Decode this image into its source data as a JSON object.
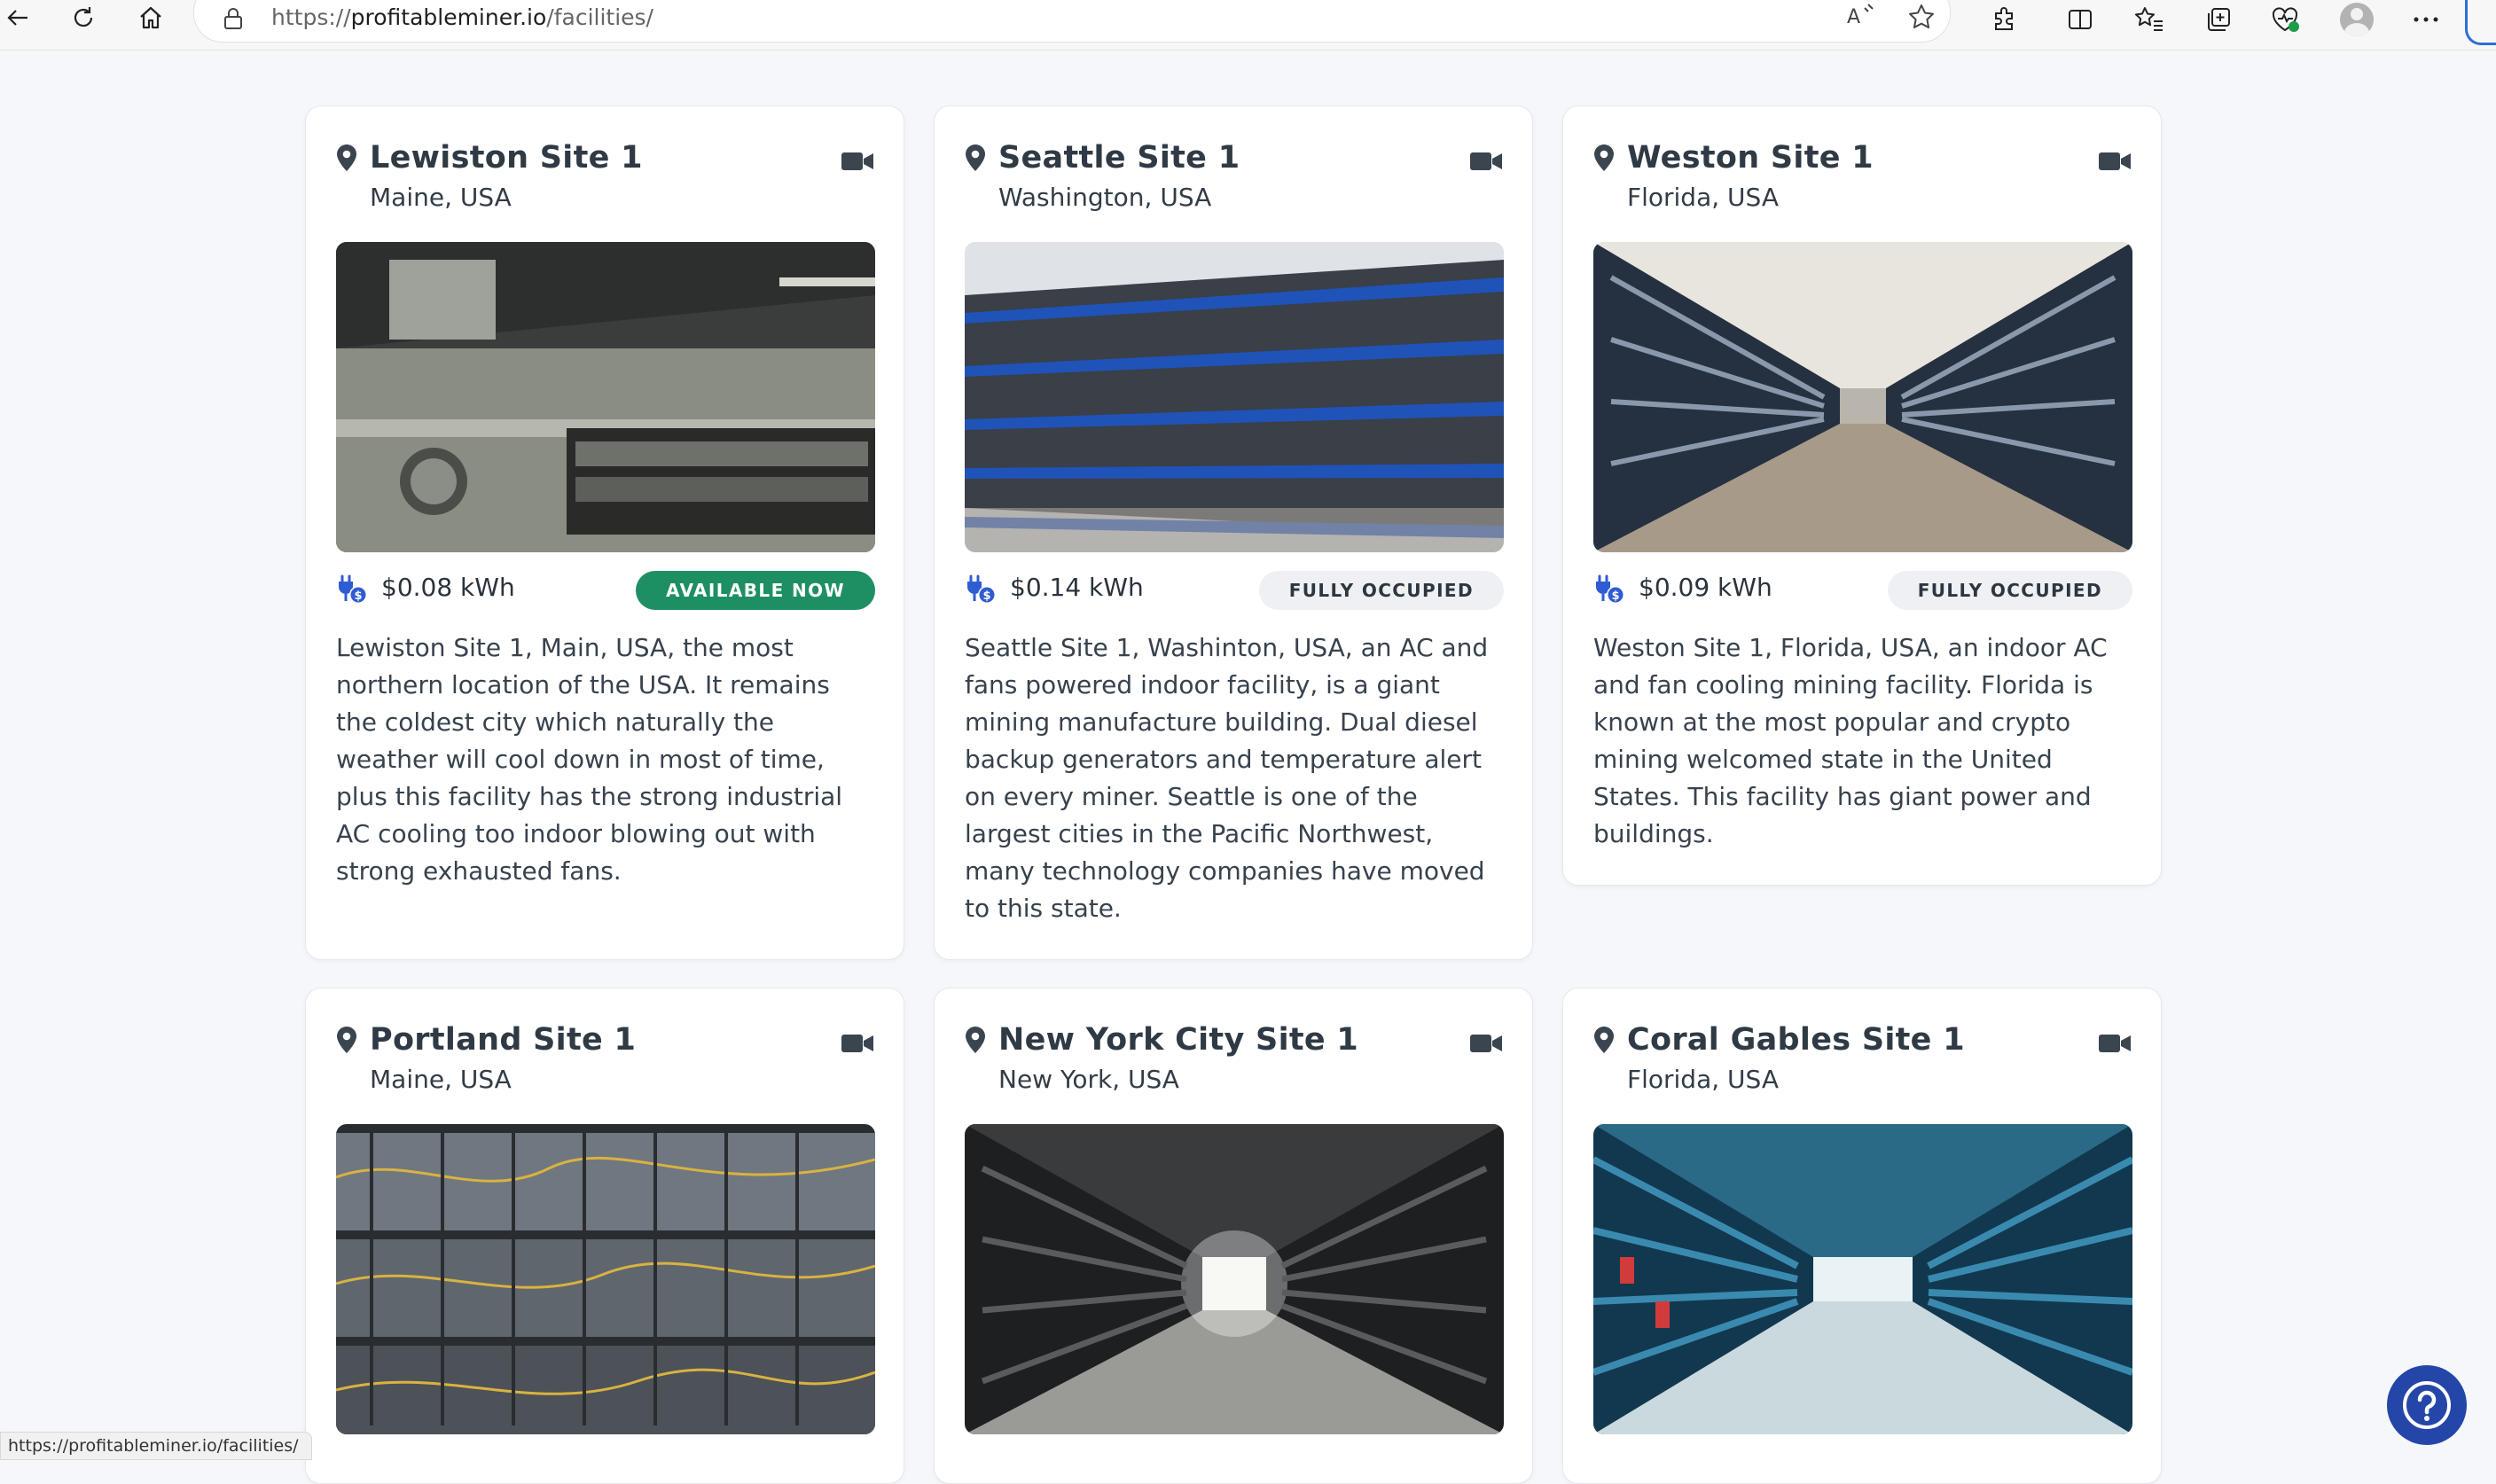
{
  "browser": {
    "url_prefix": "https://",
    "url_host": "profitableminer.io",
    "url_path": "/facilities/",
    "status_url": "https://profitableminer.io/facilities/",
    "icons": [
      "back-icon",
      "refresh-icon",
      "home-icon",
      "lock-icon",
      "read-aloud-icon",
      "favorite-star-icon",
      "extensions-icon",
      "split-screen-icon",
      "favorites-icon",
      "collections-icon",
      "browser-essentials-icon",
      "profile-avatar-icon",
      "more-options-icon"
    ]
  },
  "facilities": [
    {
      "name": "Lewiston Site 1",
      "location": "Maine, USA",
      "price": "$0.08 kWh",
      "status": "AVAILABLE NOW",
      "status_type": "available",
      "description": "Lewiston Site 1, Main, USA, the most northern location of the USA. It remains the coldest city which naturally the weather will cool down in most of time, plus this facility has the strong industrial AC cooling too indoor blowing out with strong exhausted fans."
    },
    {
      "name": "Seattle Site 1",
      "location": "Washington, USA",
      "price": "$0.14 kWh",
      "status": "FULLY OCCUPIED",
      "status_type": "occupied",
      "description": "Seattle Site 1, Washinton, USA, an AC and fans powered indoor facility, is a giant mining manufacture building. Dual diesel backup generators and temperature alert on every miner. Seattle is one of the largest cities in the Pacific Northwest, many technology companies have moved to this state."
    },
    {
      "name": "Weston Site 1",
      "location": "Florida, USA",
      "price": "$0.09 kWh",
      "status": "FULLY OCCUPIED",
      "status_type": "occupied",
      "description": "Weston Site 1, Florida, USA, an indoor AC and fan cooling mining facility. Florida is known at the most popular and crypto mining welcomed state in the United States. This facility has giant power and buildings."
    },
    {
      "name": "Portland Site 1",
      "location": "Maine, USA"
    },
    {
      "name": "New York City Site 1",
      "location": "New York, USA"
    },
    {
      "name": "Coral Gables Site 1",
      "location": "Florida, USA"
    }
  ],
  "colors": {
    "available_badge": "#1e8f63",
    "occupied_badge": "#eef0f3",
    "help_button": "#2446a8",
    "plug_icon": "#2f5bd3"
  }
}
